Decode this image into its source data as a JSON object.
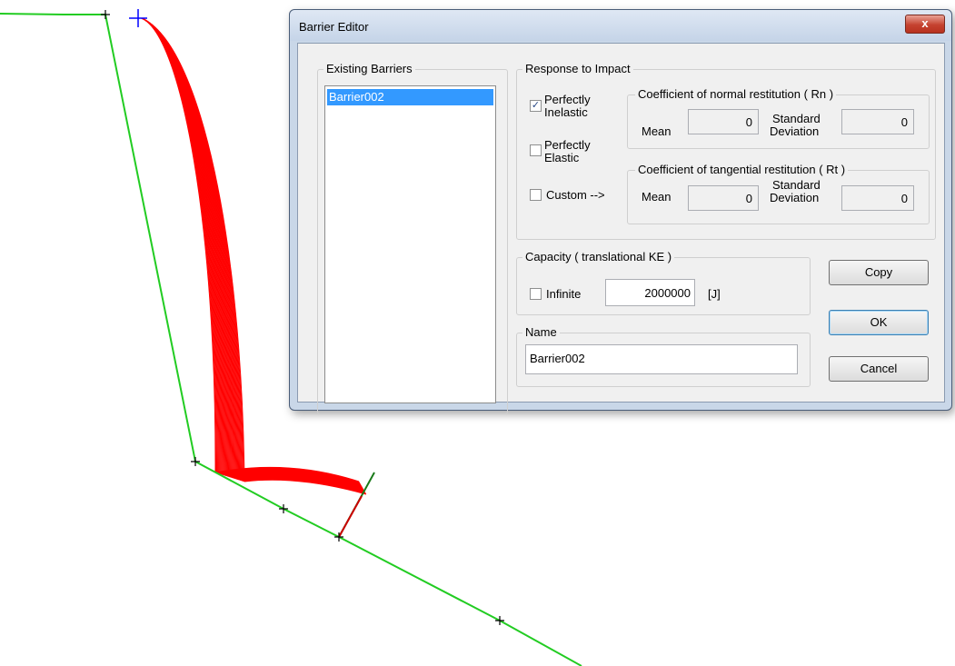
{
  "dialog": {
    "title": "Barrier Editor",
    "close_glyph": "x",
    "existing_barriers": {
      "label": "Existing Barriers",
      "items": [
        "Barrier002"
      ],
      "selected": "Barrier002"
    },
    "response": {
      "label": "Response to Impact",
      "perfectly_inelastic": {
        "line1": "Perfectly",
        "line2": "Inelastic",
        "checked": true
      },
      "perfectly_elastic": {
        "line1": "Perfectly",
        "line2": "Elastic",
        "checked": false
      },
      "custom": {
        "label": "Custom -->",
        "checked": false
      },
      "normal": {
        "label": "Coefficient of normal restitution ( Rn )",
        "mean_label": "Mean",
        "mean": "0",
        "sd_line1": "Standard",
        "sd_line2": "Deviation",
        "sd": "0"
      },
      "tangential": {
        "label": "Coefficient of tangential restitution ( Rt )",
        "mean_label": "Mean",
        "mean": "0",
        "sd_line1": "Standard",
        "sd_line2": "Deviation",
        "sd": "0"
      }
    },
    "capacity": {
      "label": "Capacity ( translational KE )",
      "infinite_label": "Infinite",
      "infinite_checked": false,
      "value": "2000000",
      "unit": "[J]"
    },
    "name": {
      "label": "Name",
      "value": "Barrier002"
    },
    "buttons": {
      "copy": "Copy",
      "ok": "OK",
      "cancel": "Cancel"
    }
  },
  "colors": {
    "slope": "#22cc22",
    "paths": "#ff0000",
    "barrier": "#1a7a1a",
    "start_marker": "#0000ff"
  }
}
